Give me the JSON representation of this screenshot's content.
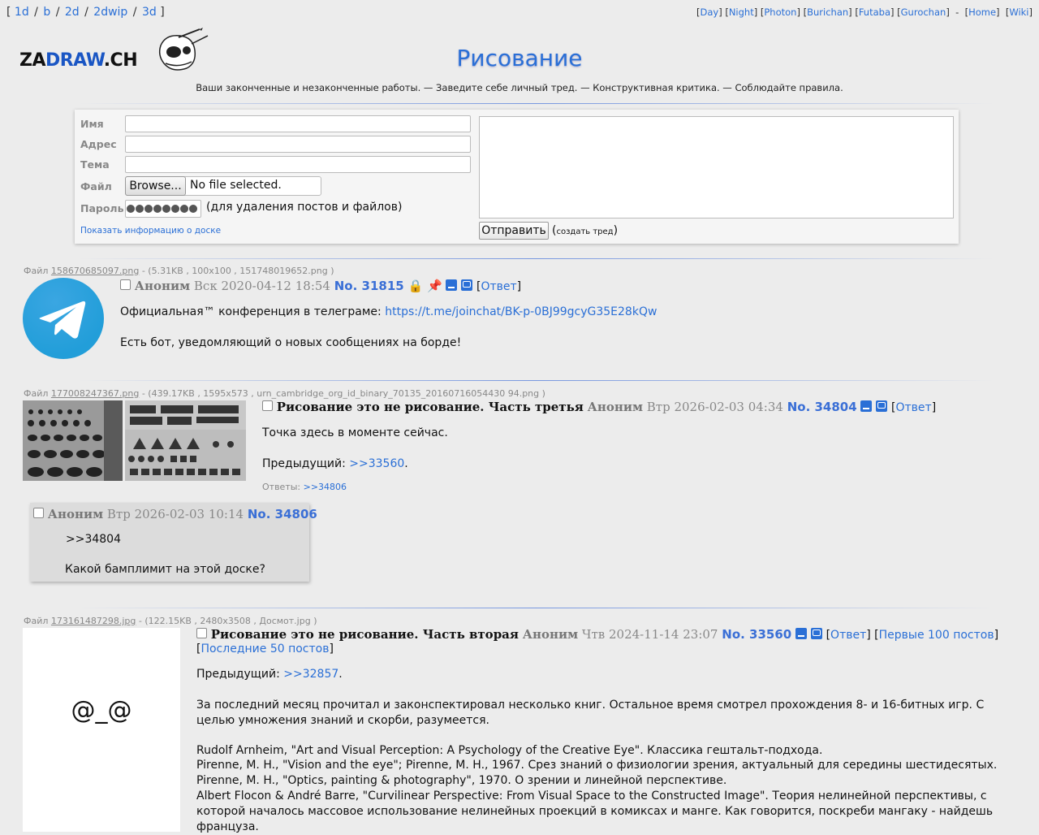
{
  "top_boards": [
    "1d",
    "b",
    "2d",
    "2dwip",
    "3d"
  ],
  "styles": [
    "Day",
    "Night",
    "Photon",
    "Burichan",
    "Futaba",
    "Gurochan"
  ],
  "top_links": [
    "Home",
    "Wiki"
  ],
  "logo": {
    "left": "ZA",
    "mid": "DRAW",
    "right": ".CH"
  },
  "board": {
    "title": "Рисование",
    "subtitle": "Ваши законченные и незаконченные работы. — Заведите себе личный тред. — Конструктивная критика. — Соблюдайте правила."
  },
  "form": {
    "name_label": "Имя",
    "email_label": "Адрес",
    "subject_label": "Тема",
    "file_label": "Файл",
    "password_label": "Пароль",
    "browse_label": "Browse...",
    "file_status": "No file selected.",
    "password_note": "(для удаления постов и файлов)",
    "board_info_link": "Показать информацию о доске",
    "submit_label": "Отправить",
    "submit_note": "создать тред"
  },
  "posts": [
    {
      "file_prefix": "Файл",
      "file_name": "158670685097.png",
      "file_meta": "- (5.31KB , 100x100 , 151748019652.png )",
      "subject": "",
      "author": "Аноним",
      "date": "Вск 2020-04-12 18:54",
      "number": "No. 31815",
      "reply_label": "Ответ",
      "line1_prefix": "Официальная™ конференция в телеграме: ",
      "link": "https://t.me/joinchat/BK-p-0BJ99gcyG35E28kQw",
      "line2": "Есть бот, уведомляющий о новых сообщениях на борде!"
    },
    {
      "file_prefix": "Файл",
      "file_name": "177008247367.png",
      "file_meta": "- (439.17KB , 1595x573 , urn_cambridge_org_id_binary_70135_20160716054430 94.png )",
      "subject": "Рисование это не рисование. Часть третья",
      "author": "Аноним",
      "date": "Втр 2026-02-03 04:34",
      "number": "No. 34804",
      "reply_label": "Ответ",
      "line1": "Точка здесь в моменте сейчас.",
      "prev_prefix": "Предыдущий: ",
      "prev_link": ">>33560",
      "replies_prefix": "Ответы: ",
      "replies_link": ">>34806"
    },
    {
      "author": "Аноним",
      "date": "Втр 2026-02-03 10:14",
      "number": "No. 34806",
      "quote": ">>34804",
      "text": "Какой бамплимит на этой доске?"
    },
    {
      "file_prefix": "Файл",
      "file_name": "173161487298.jpg",
      "file_meta": "- (122.15KB , 2480x3508 , Досмот.jpg )",
      "thumb_text": "@_@",
      "subject": "Рисование это не рисование. Часть вторая",
      "author": "Аноним",
      "date": "Чтв 2024-11-14 23:07",
      "number": "No. 33560",
      "reply_label": "Ответ",
      "first100": "Первые 100 постов",
      "last50": "Последние 50 постов",
      "prev_prefix": "Предыдущий: ",
      "prev_link": ">>32857",
      "para1": "За последний месяц прочитал и законспектировал несколько книг. Остальное время смотрел прохождения 8- и 16-битных игр. С целью умножения знаний и скорби, разумеется.",
      "ref1": "Rudolf Arnheim, \"Art and Visual Perception: A Psychology of the Creative Eye\". Классика гештальт-подхода.",
      "ref2": "Pirenne, M. H., \"Vision and the eye\"; Pirenne, M. H., 1967. Срез знаний о физиологии зрения, актуальный для середины шестидесятых.",
      "ref3": "Pirenne, M. H., \"Optics, painting & photography\", 1970. О зрении и линейной перспективе.",
      "ref4": "Albert Flocon & André Barre, \"Curvilinear Perspective: From Visual Space to the Constructed Image\". Теория нелинейной перспективы, с которой началось массовое использование нелинейных проекций в комиксах и манге. Как говорится, поскреби мангаку - найдешь француза."
    }
  ]
}
